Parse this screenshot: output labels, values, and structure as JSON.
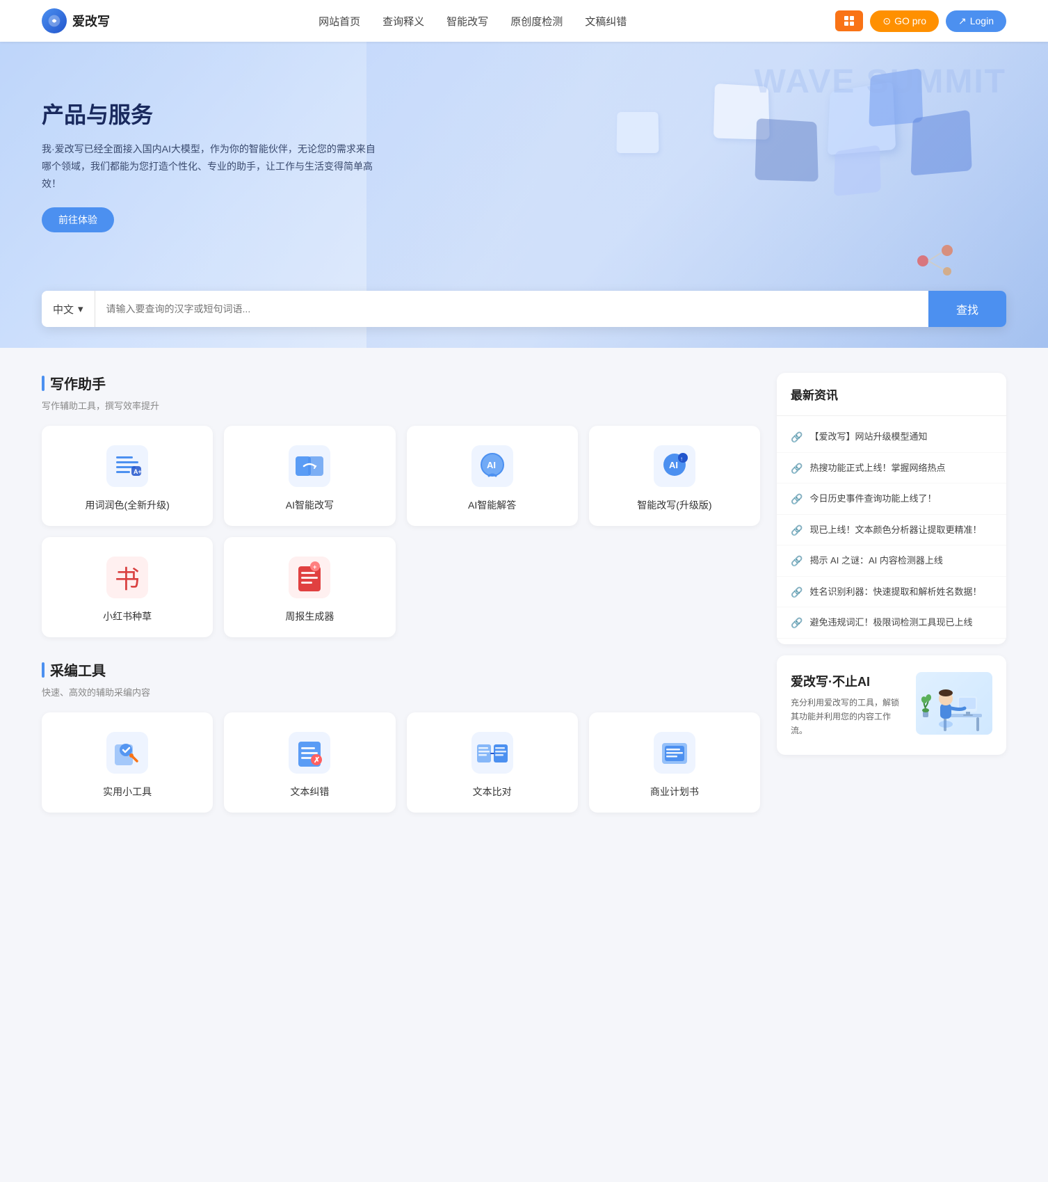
{
  "nav": {
    "logo_icon": "✍",
    "logo_text": "爱改写",
    "links": [
      {
        "label": "网站首页",
        "id": "home"
      },
      {
        "label": "查询释义",
        "id": "query"
      },
      {
        "label": "智能改写",
        "id": "rewrite"
      },
      {
        "label": "原创度检测",
        "id": "original"
      },
      {
        "label": "文稿纠错",
        "id": "correct"
      }
    ],
    "btn_grid_label": "⊞",
    "btn_go_icon": "☀",
    "btn_go_label": "GO pro",
    "btn_login_icon": "→",
    "btn_login_label": "Login"
  },
  "hero": {
    "title": "产品与服务",
    "desc": "我·爱改写已经全面接入国内AI大模型，作为你的智能伙伴，无论您的需求来自哪个领域，我们都能为您打造个性化、专业的助手，让工作与生活变得简单高效！",
    "btn_label": "前往体验"
  },
  "search": {
    "lang": "中文",
    "lang_arrow": "▾",
    "placeholder": "请输入要查询的汉字或短句词语...",
    "btn_label": "查找"
  },
  "writing": {
    "section_title": "写作助手",
    "section_subtitle": "写作辅助工具，撰写效率提升",
    "tools": [
      {
        "label": "用词润色(全新升级)",
        "icon_type": "writing1",
        "emoji": "📄"
      },
      {
        "label": "AI智能改写",
        "icon_type": "writing2",
        "emoji": "🔄"
      },
      {
        "label": "AI智能解答",
        "icon_type": "writing3",
        "emoji": "💬"
      },
      {
        "label": "智能改写(升级版)",
        "icon_type": "writing4",
        "emoji": "🤖"
      },
      {
        "label": "小红书种草",
        "icon_type": "writing5",
        "emoji": "📕"
      },
      {
        "label": "周报生成器",
        "icon_type": "writing6",
        "emoji": "📋"
      }
    ]
  },
  "caimi": {
    "section_title": "采编工具",
    "section_subtitle": "快速、高效的辅助采编内容",
    "tools": [
      {
        "label": "实用小工具",
        "icon_type": "tool1",
        "emoji": "🔧"
      },
      {
        "label": "文本纠错",
        "icon_type": "tool2",
        "emoji": "📝"
      },
      {
        "label": "文本比对",
        "icon_type": "tool3",
        "emoji": "🔍"
      },
      {
        "label": "商业计划书",
        "icon_type": "tool4",
        "emoji": "📊"
      }
    ]
  },
  "news": {
    "title": "最新资讯",
    "items": [
      {
        "text": "【爱改写】网站升级模型通知"
      },
      {
        "text": "热搜功能正式上线！掌握网络热点"
      },
      {
        "text": "今日历史事件查询功能上线了！"
      },
      {
        "text": "现已上线！文本颜色分析器让提取更精准！"
      },
      {
        "text": "揭示 AI 之谜：AI 内容检测器上线"
      },
      {
        "text": "姓名识别利器：快速提取和解析姓名数据！"
      },
      {
        "text": "避免违规词汇！极限词检测工具现已上线"
      }
    ]
  },
  "ad": {
    "title": "爱改写·不止AI",
    "desc": "充分利用爱改写的工具，解锁其功能并利用您的内容工作流。"
  }
}
